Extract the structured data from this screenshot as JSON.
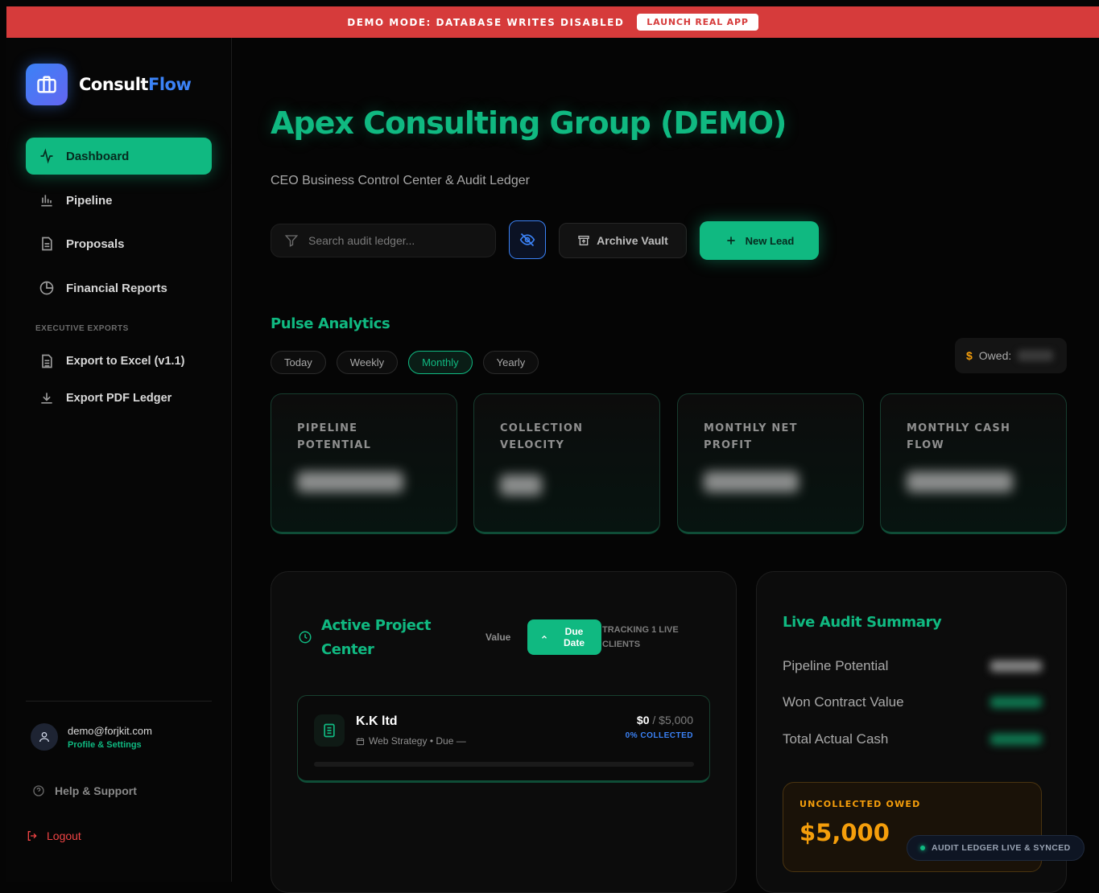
{
  "banner": {
    "text": "DEMO MODE: DATABASE WRITES DISABLED",
    "button": "LAUNCH REAL APP"
  },
  "brand": {
    "name_a": "Consult",
    "name_b": "Flow"
  },
  "nav": {
    "items": [
      {
        "label": "Dashboard",
        "icon": "activity-icon",
        "active": true
      },
      {
        "label": "Pipeline",
        "icon": "bar-chart-icon"
      },
      {
        "label": "Proposals",
        "icon": "document-icon"
      },
      {
        "label": "Financial Reports",
        "icon": "pie-chart-icon"
      }
    ],
    "section_label": "EXECUTIVE EXPORTS",
    "exports": [
      {
        "label": "Export to Excel (v1.1)",
        "icon": "spreadsheet-icon"
      },
      {
        "label": "Export PDF Ledger",
        "icon": "download-icon"
      }
    ]
  },
  "user": {
    "email": "demo@forjkit.com",
    "sub": "Profile & Settings"
  },
  "help": "Help & Support",
  "logout": "Logout",
  "header": {
    "title": "Apex Consulting Group (DEMO)",
    "subtitle": "CEO Business Control Center & Audit Ledger"
  },
  "toolbar": {
    "search_placeholder": "Search audit ledger...",
    "archive": "Archive Vault",
    "new_lead": "New Lead"
  },
  "pulse": {
    "title": "Pulse Analytics",
    "periods": [
      "Today",
      "Weekly",
      "Monthly",
      "Yearly"
    ],
    "active_period": "Monthly",
    "owed_label": "Owed:"
  },
  "cards": [
    {
      "label": "PIPELINE POTENTIAL"
    },
    {
      "label": "COLLECTION VELOCITY"
    },
    {
      "label": "MONTHLY NET PROFIT"
    },
    {
      "label": "MONTHLY CASH FLOW"
    }
  ],
  "project_center": {
    "title": "Active Project Center",
    "value_label": "Value",
    "due_label": "Due Date",
    "tracking": "TRACKING 1 LIVE CLIENTS",
    "projects": [
      {
        "name": "K.K ltd",
        "meta": "Web Strategy • Due —",
        "paid": "$0",
        "total": "/ $5,000",
        "collected": "0% COLLECTED",
        "progress": 0
      }
    ]
  },
  "audit": {
    "title": "Live Audit Summary",
    "rows": [
      {
        "label": "Pipeline Potential",
        "color": "#8a8a8a"
      },
      {
        "label": "Won Contract Value",
        "color": "#0f7a52"
      },
      {
        "label": "Total Actual Cash",
        "color": "#0f7a52"
      }
    ],
    "uncollected_label": "UNCOLLECTED OWED",
    "uncollected_value": "$5,000"
  },
  "status": "AUDIT LEDGER LIVE & SYNCED",
  "colors": {
    "accent": "#10b981",
    "banner": "#d63b3b",
    "owed": "#f59e0b",
    "brand_blue": "#3b82f6"
  }
}
